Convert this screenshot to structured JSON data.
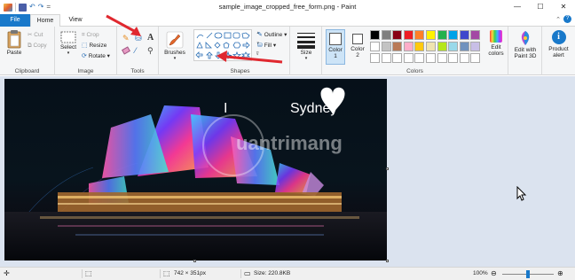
{
  "window": {
    "title": "sample_image_cropped_free_form.png - Paint",
    "minimize": "—",
    "maximize": "☐",
    "close": "✕"
  },
  "quick_access": {
    "dropdown": "="
  },
  "tabs": {
    "file": "File",
    "home": "Home",
    "view": "View"
  },
  "ribbon": {
    "clipboard": {
      "label": "Clipboard",
      "paste": "Paste",
      "cut": "Cut",
      "copy": "Copy"
    },
    "image": {
      "label": "Image",
      "select": "Select",
      "crop": "Crop",
      "resize": "Resize",
      "rotate": "Rotate"
    },
    "tools": {
      "label": "Tools",
      "text_icon": "A"
    },
    "brushes": {
      "label": "Brushes"
    },
    "shapes": {
      "label": "Shapes",
      "outline": "Outline",
      "fill": "Fill"
    },
    "size": {
      "label": "Size"
    },
    "colors": {
      "label": "Colors",
      "color1": "Color\n1",
      "color1_line1": "Color",
      "color1_line2": "1",
      "color2_line1": "Color",
      "color2_line2": "2",
      "edit_colors_line1": "Edit",
      "edit_colors_line2": "colors",
      "edit_paint3d_line1": "Edit with",
      "edit_paint3d_line2": "Paint 3D",
      "product_alert_line1": "Product",
      "product_alert_line2": "alert",
      "palette_row1": [
        "#000000",
        "#7f7f7f",
        "#880015",
        "#ed1c24",
        "#ff7f27",
        "#fff200",
        "#22b14c",
        "#00a2e8",
        "#3f48cc",
        "#a349a4"
      ],
      "palette_row2": [
        "#ffffff",
        "#c3c3c3",
        "#b97a57",
        "#ffaec9",
        "#ffc90e",
        "#efe4b0",
        "#b5e61d",
        "#99d9ea",
        "#7092be",
        "#c8bfe7"
      ]
    }
  },
  "canvas_image": {
    "text_left": "I",
    "text_right": "Sydney",
    "watermark": "uantrimang"
  },
  "status": {
    "dimensions": "742 × 351px",
    "size": "Size: 220.8KB",
    "zoom": "100%",
    "zoom_out": "⊖",
    "zoom_in": "⊕",
    "zoom_level_fraction": 0.5
  },
  "colors": {
    "accent": "#1979ca",
    "arrow": "#e0282f",
    "ribbon_bg": "#f5f6f7",
    "workspace": "#dbe3ef"
  }
}
